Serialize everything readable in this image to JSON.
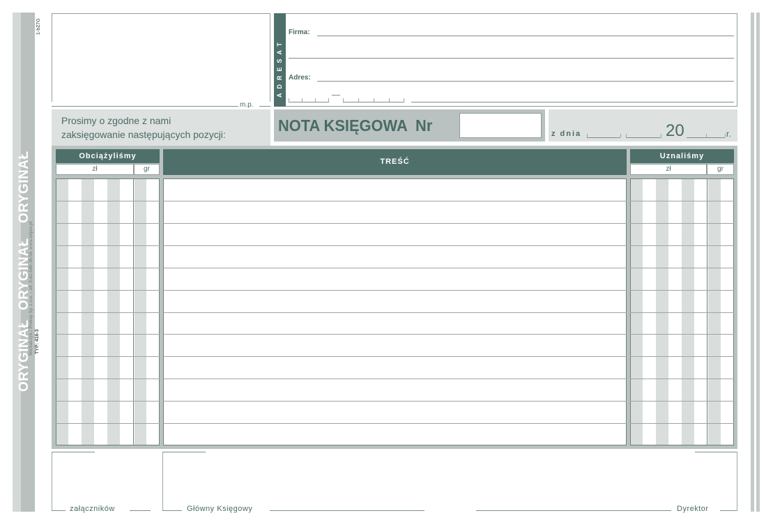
{
  "side": {
    "code_top": "1-b27G",
    "original_1": "ORYGINAŁ",
    "original_2": "ORYGINAŁ",
    "original_3": "ORYGINAŁ",
    "typ": "TYP: 416-3",
    "publisher": "Michalczyk i Prokop Sp. z o.o. – tel. 0-42-640-38-54, www.mipro.pl"
  },
  "stamp": {
    "mp_label": "m.p."
  },
  "adresat": {
    "vertical_label": "ADRESAT",
    "firma_label": "Firma:",
    "adres_label": "Adres:"
  },
  "request": {
    "line1": "Prosimy o zgodne z nami",
    "line2": "zaksięgowanie następujących pozycji:"
  },
  "title": {
    "text": "NOTA KSIĘGOWA  Nr",
    "number": ""
  },
  "date": {
    "prefix": "z dnia",
    "year": "20",
    "suffix": "r."
  },
  "table": {
    "left_header": "Obciążyliśmy",
    "left_zl": "zł",
    "left_gr": "gr",
    "middle_header": "TREŚĆ",
    "right_header": "Uznaliśmy",
    "right_zl": "zł",
    "right_gr": "gr",
    "row_count": 12
  },
  "footer": {
    "attachments": "załączników",
    "chief_accountant": "Główny Księgowy",
    "director": "Dyrektor"
  }
}
